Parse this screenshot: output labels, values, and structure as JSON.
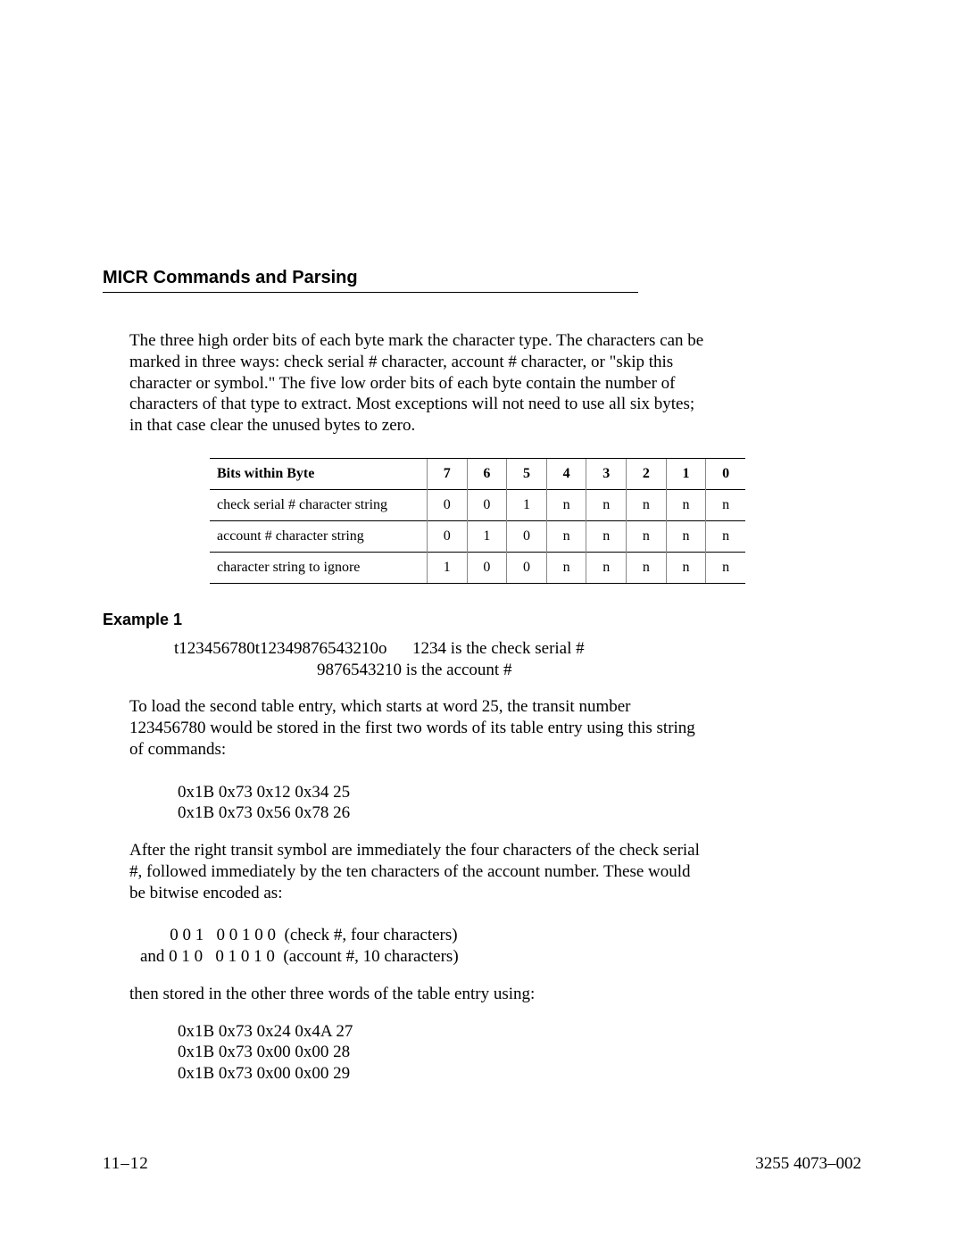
{
  "header": {
    "section_title": "MICR Commands and Parsing"
  },
  "intro_para": "The three high order bits of each byte mark the character type. The characters can be marked in three ways: check serial # character, account # character, or \"skip this character or symbol.\" The five low order bits of each byte contain the number of characters of that type to extract. Most exceptions will not need to use all six bytes; in that case clear the unused bytes to zero.",
  "table": {
    "header_label": "Bits within Byte",
    "bit_cols": [
      "7",
      "6",
      "5",
      "4",
      "3",
      "2",
      "1",
      "0"
    ],
    "rows": [
      {
        "label": "check serial # character string",
        "cells": [
          "0",
          "0",
          "1",
          "n",
          "n",
          "n",
          "n",
          "n"
        ]
      },
      {
        "label": "account # character string",
        "cells": [
          "0",
          "1",
          "0",
          "n",
          "n",
          "n",
          "n",
          "n"
        ]
      },
      {
        "label": "character string to ignore",
        "cells": [
          "1",
          "0",
          "0",
          "n",
          "n",
          "n",
          "n",
          "n"
        ]
      }
    ]
  },
  "example": {
    "title": "Example 1",
    "line1": "t123456780t12349876543210o      1234 is the check serial #",
    "line2": "9876543210 is the account #",
    "para1": "To load the second table entry, which starts at word 25, the transit number 123456780 would be stored in the first two words of its table entry using this string of commands:",
    "cmd_block1": "0x1B 0x73 0x12 0x34 25\n0x1B 0x73 0x56 0x78 26",
    "para2": "After the right transit symbol are immediately the four characters of the check serial #, followed immediately by the ten characters of the account number. These would be bitwise encoded as:",
    "bitwise": "       0 0 1   0 0 1 0 0  (check #, four characters)\nand 0 1 0   0 1 0 1 0  (account #, 10 characters)",
    "para3": "then stored in the other three words of the table entry using:",
    "cmd_block2": "0x1B 0x73 0x24 0x4A 27\n0x1B 0x73 0x00 0x00 28\n0x1B 0x73 0x00 0x00 29"
  },
  "footer": {
    "left": "11–12",
    "right": "3255 4073–002"
  }
}
